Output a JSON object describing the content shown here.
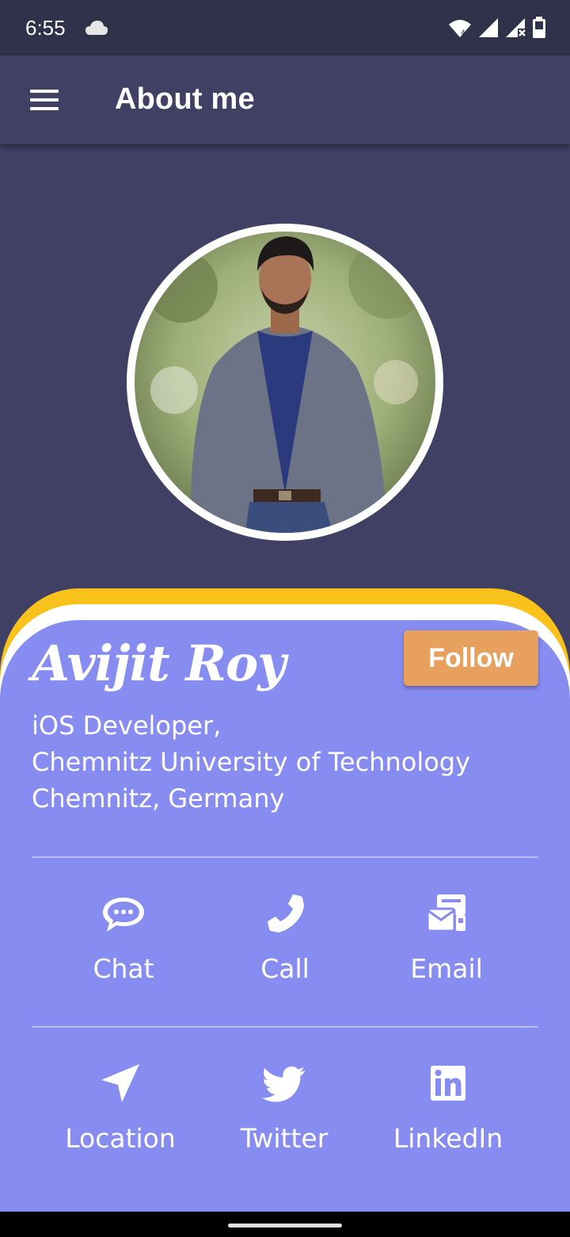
{
  "status_bar": {
    "time": "6:55",
    "icons": [
      "cloud-icon",
      "wifi-icon",
      "signal-icon",
      "signal-off-icon",
      "battery-icon"
    ]
  },
  "app_bar": {
    "title": "About me",
    "menu_icon": "menu-icon"
  },
  "profile": {
    "name": "Avijit Roy",
    "follow_label": "Follow",
    "bio": [
      "iOS Developer,",
      "Chemnitz University of Technology",
      "Chemnitz, Germany"
    ]
  },
  "actions_row1": [
    {
      "label": "Chat",
      "icon": "chat-icon"
    },
    {
      "label": "Call",
      "icon": "phone-icon"
    },
    {
      "label": "Email",
      "icon": "email-icon"
    }
  ],
  "actions_row2": [
    {
      "label": "Location",
      "icon": "location-icon"
    },
    {
      "label": "Twitter",
      "icon": "twitter-icon"
    },
    {
      "label": "LinkedIn",
      "icon": "linkedin-icon"
    }
  ],
  "colors": {
    "background": "#3f4064",
    "status_bar": "#30314a",
    "card": "#878cf1",
    "card_accent": "#f8c21b",
    "follow_button": "#e8a05e"
  }
}
